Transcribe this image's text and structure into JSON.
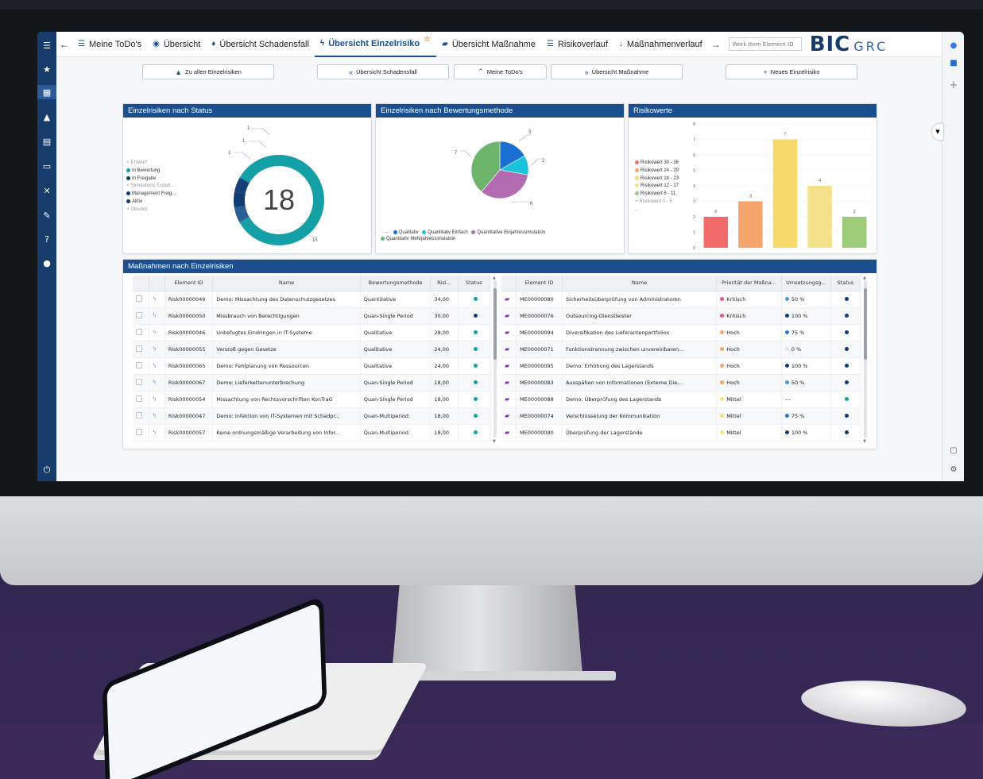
{
  "colors": {
    "brand": "#1b4f8f",
    "teal": "#14a0a6",
    "navy": "#0f3c73"
  },
  "leftbar": {
    "icons": [
      "menu-logo-icon",
      "star-icon",
      "dashboard-icon",
      "shapes-icon",
      "report-icon",
      "monitor-icon",
      "network-icon",
      "wrench-icon",
      "help-icon",
      "user-icon",
      "power-icon"
    ]
  },
  "topbar": {
    "tabs": [
      {
        "label": "Meine ToDo's",
        "icon": "list-icon"
      },
      {
        "label": "Übersicht",
        "icon": "eye-icon"
      },
      {
        "label": "Übersicht Schadensfall",
        "icon": "flame-icon"
      },
      {
        "label": "Übersicht Einzelrisiko",
        "icon": "bolt-icon"
      },
      {
        "label": "Übersicht Maßnahme",
        "icon": "measure-icon"
      },
      {
        "label": "Risikoverlauf",
        "icon": "list-icon"
      },
      {
        "label": "Maßnahmenverlauf",
        "icon": "sort-icon"
      }
    ],
    "search_placeholder": "Work Item Element ID",
    "logo_main": "BIC",
    "logo_sub": "GRC"
  },
  "buttons": {
    "all_risks": "Zu allen Einzelrisiken",
    "overview_damage": "Übersicht Schadensfall",
    "my_todos": "Meine ToDo's",
    "overview_measure": "Übersicht Maßnahme",
    "new_risk": "Neues Einzelrisiko"
  },
  "status_card": {
    "title": "Einzelrisiken nach Status",
    "total": "18",
    "legend": [
      {
        "label": "Entwurf",
        "color": "",
        "active": false
      },
      {
        "label": "In Bewertung",
        "color": "#14a0a6",
        "active": true
      },
      {
        "label": "In Freigabe",
        "color": "#0f3c73",
        "active": true
      },
      {
        "label": "Simulations Expert...",
        "color": "",
        "active": false
      },
      {
        "label": "Management Freig...",
        "color": "#0f3c73",
        "active": true
      },
      {
        "label": "Aktiv",
        "color": "#0f3c73",
        "active": true
      },
      {
        "label": "Obsolet",
        "color": "",
        "active": false
      }
    ],
    "callouts": [
      "1",
      "1",
      "1",
      "15"
    ]
  },
  "method_card": {
    "title": "Einzelrisiken nach Bewertungsmethode",
    "callouts": [
      "3",
      "2",
      "7",
      "6"
    ],
    "legend": [
      {
        "label": "Qualitativ",
        "color": "#1b6fd0"
      },
      {
        "label": "Quantitativ Einfach",
        "color": "#19c3dc"
      },
      {
        "label": "Quantitative Einjahressimulation",
        "color": "#b36cb0"
      },
      {
        "label": "Quantitativ Mehrjahressimulation",
        "color": "#6db56d"
      }
    ],
    "legend_dash": "—"
  },
  "risk_card": {
    "title": "Risikowerte",
    "legend": [
      {
        "label": "Risikowert 30 - 36",
        "color": "#f26b6b",
        "active": true
      },
      {
        "label": "Risikowert 24 - 29",
        "color": "#f5a56b",
        "active": true
      },
      {
        "label": "Risikowert 18 - 23",
        "color": "#f8d96b",
        "active": true
      },
      {
        "label": "Risikowert 12 - 17",
        "color": "#f3e28a",
        "active": true
      },
      {
        "label": "Risikowert 6 - 11",
        "color": "#9ccc78",
        "active": true
      },
      {
        "label": "Risikowert 0 - 5",
        "color": "",
        "active": false
      }
    ],
    "legend_more": "..."
  },
  "chart_data": [
    {
      "type": "pie",
      "title": "Einzelrisiken nach Status",
      "variant": "donut",
      "center_label": "18",
      "categories": [
        "In Bewertung",
        "In Freigabe",
        "Management Freig...",
        "Aktiv"
      ],
      "values": [
        15,
        1,
        1,
        1
      ],
      "colors": [
        "#14a0a6",
        "#2a5d95",
        "#0f3c73",
        "#173f7a"
      ]
    },
    {
      "type": "pie",
      "title": "Einzelrisiken nach Bewertungsmethode",
      "categories": [
        "Qualitativ",
        "Quantitativ Einfach",
        "Quantitative Einjahressimulation",
        "Quantitativ Mehrjahressimulation"
      ],
      "values": [
        3,
        2,
        6,
        7
      ],
      "colors": [
        "#1b6fd0",
        "#19c3dc",
        "#b36cb0",
        "#6db56d"
      ]
    },
    {
      "type": "bar",
      "title": "Risikowerte",
      "categories": [
        "Risikowert 30 - 36",
        "Risikowert 24 - 29",
        "Risikowert 18 - 23",
        "Risikowert 12 - 17",
        "Risikowert 6 - 11"
      ],
      "values": [
        2,
        3,
        7,
        4,
        2
      ],
      "colors": [
        "#f26b6b",
        "#f5a56b",
        "#f8d96b",
        "#f3e28a",
        "#9ccc78"
      ],
      "ylim": [
        0,
        8
      ],
      "yticks": [
        "0",
        "1",
        "2",
        "3",
        "4",
        "5",
        "6",
        "7",
        "8"
      ],
      "grid": true,
      "legend": "left"
    }
  ],
  "measures_card": {
    "title": "Maßnahmen nach Einzelrisiken",
    "left_headers": [
      "Element ID",
      "Name",
      "Bewertungsmethode",
      "Risi...",
      "Status"
    ],
    "left_rows": [
      {
        "id": "Risk00000049",
        "name": "Demo: Missachtung des Datenschutzgesetzes",
        "method": "Quantitative",
        "value": "34,00",
        "status_color": "#14a0a6"
      },
      {
        "id": "Risk00000050",
        "name": "Missbrauch von Berechtigungen",
        "method": "Quan-Single Period",
        "value": "30,00",
        "status_color": "#0f3c73"
      },
      {
        "id": "Risk00000046",
        "name": "Unbefugtes Eindringen in IT-Systeme",
        "method": "Qualitative",
        "value": "28,00",
        "status_color": "#14a0a6"
      },
      {
        "id": "Risk00000055",
        "name": "Verstoß gegen Gesetze",
        "method": "Qualitative",
        "value": "24,00",
        "status_color": "#14a0a6"
      },
      {
        "id": "Risk00000065",
        "name": "Demo: Fehlplanung von Ressourcen",
        "method": "Qualitative",
        "value": "24,00",
        "status_color": "#14a0a6"
      },
      {
        "id": "Risk00000067",
        "name": "Demo: Lieferkettenunterbrechung",
        "method": "Quan-Single Period",
        "value": "18,00",
        "status_color": "#14a0a6"
      },
      {
        "id": "Risk00000054",
        "name": "Missachtung von Rechtsvorschriften KonTraG",
        "method": "Quan-Single Period",
        "value": "18,00",
        "status_color": "#14a0a6"
      },
      {
        "id": "Risk00000047",
        "name": "Demo: Infektion von IT-Systemen mit Schadpr...",
        "method": "Quan-Multiperiod",
        "value": "18,00",
        "status_color": "#14a0a6"
      },
      {
        "id": "Risk00000057",
        "name": "Keine ordnungsmäßige Verarbeitung von Infor...",
        "method": "Quan-Multiperiod",
        "value": "18,00",
        "status_color": "#14a0a6"
      }
    ],
    "right_headers": [
      "Element ID",
      "Name",
      "Priorität der Maßna...",
      "Umsetzungsg...",
      "Status"
    ],
    "right_rows": [
      {
        "id": "ME00000080",
        "name": "Sicherheitsüberprüfung von Administratoren",
        "priority": "Kritisch",
        "priority_color": "#e8587a",
        "progress": "50 %",
        "progress_color": "#4b9ad8",
        "status_color": "#0f3c73"
      },
      {
        "id": "ME00000076",
        "name": "Outsourcing-Dienstleister",
        "priority": "Kritisch",
        "priority_color": "#e8587a",
        "progress": "100 %",
        "progress_color": "#0f3c73",
        "status_color": "#0f3c73"
      },
      {
        "id": "ME00000094",
        "name": "Diversifikation des Lieferantenportfolios",
        "priority": "Hoch",
        "priority_color": "#f5a56b",
        "progress": "75 %",
        "progress_color": "#2a77c6",
        "status_color": "#0f3c73"
      },
      {
        "id": "ME00000071",
        "name": "Funktionstrennung zwischen unvereinbaren...",
        "priority": "Hoch",
        "priority_color": "#f5a56b",
        "progress": "0 %",
        "progress_color": "#d6e8f6",
        "status_color": "#0f3c73"
      },
      {
        "id": "ME00000095",
        "name": "Demo: Erhöhung des Lagerstands",
        "priority": "Hoch",
        "priority_color": "#f5a56b",
        "progress": "100 %",
        "progress_color": "#0f3c73",
        "status_color": "#0f3c73"
      },
      {
        "id": "ME00000083",
        "name": "Ausspähen von Informationen (Externe Die...",
        "priority": "Hoch",
        "priority_color": "#f5a56b",
        "progress": "50 %",
        "progress_color": "#4b9ad8",
        "status_color": "#0f3c73"
      },
      {
        "id": "ME00000088",
        "name": "Demo: Überprüfung des Lagerstands",
        "priority": "Mittel",
        "priority_color": "#f8e27a",
        "progress": "---",
        "progress_color": "",
        "status_color": "#14a0a6"
      },
      {
        "id": "ME00000074",
        "name": "Verschlüsselung der Kommunikation",
        "priority": "Mittel",
        "priority_color": "#f8e27a",
        "progress": "75 %",
        "progress_color": "#2a77c6",
        "status_color": "#0f3c73"
      },
      {
        "id": "ME00000090",
        "name": "Überprüfung der Lagerstände",
        "priority": "Mittel",
        "priority_color": "#f8e27a",
        "progress": "100 %",
        "progress_color": "#0f3c73",
        "status_color": "#0f3c73"
      }
    ]
  }
}
